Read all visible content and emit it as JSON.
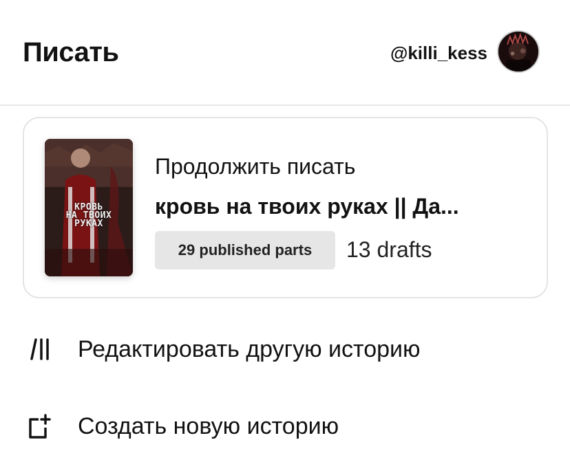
{
  "header": {
    "title": "Писать",
    "username": "@killi_kess",
    "avatar_icon": "user-avatar"
  },
  "continue_card": {
    "label": "Продолжить писать",
    "story_title": "кровь на твоих руках || Да...",
    "cover_title": "КРОВЬ\nНА ТВОИХ\nРУКАХ",
    "published_parts": "29 published parts",
    "drafts": "13 drafts"
  },
  "menu": {
    "edit_label": "Редактировать другую историю",
    "edit_icon": "edit-stories-icon",
    "create_label": "Создать новую историю",
    "create_icon": "new-story-icon"
  },
  "colors": {
    "text": "#121212",
    "divider": "#e6e6e6",
    "badge_bg": "#e6e6e6"
  }
}
